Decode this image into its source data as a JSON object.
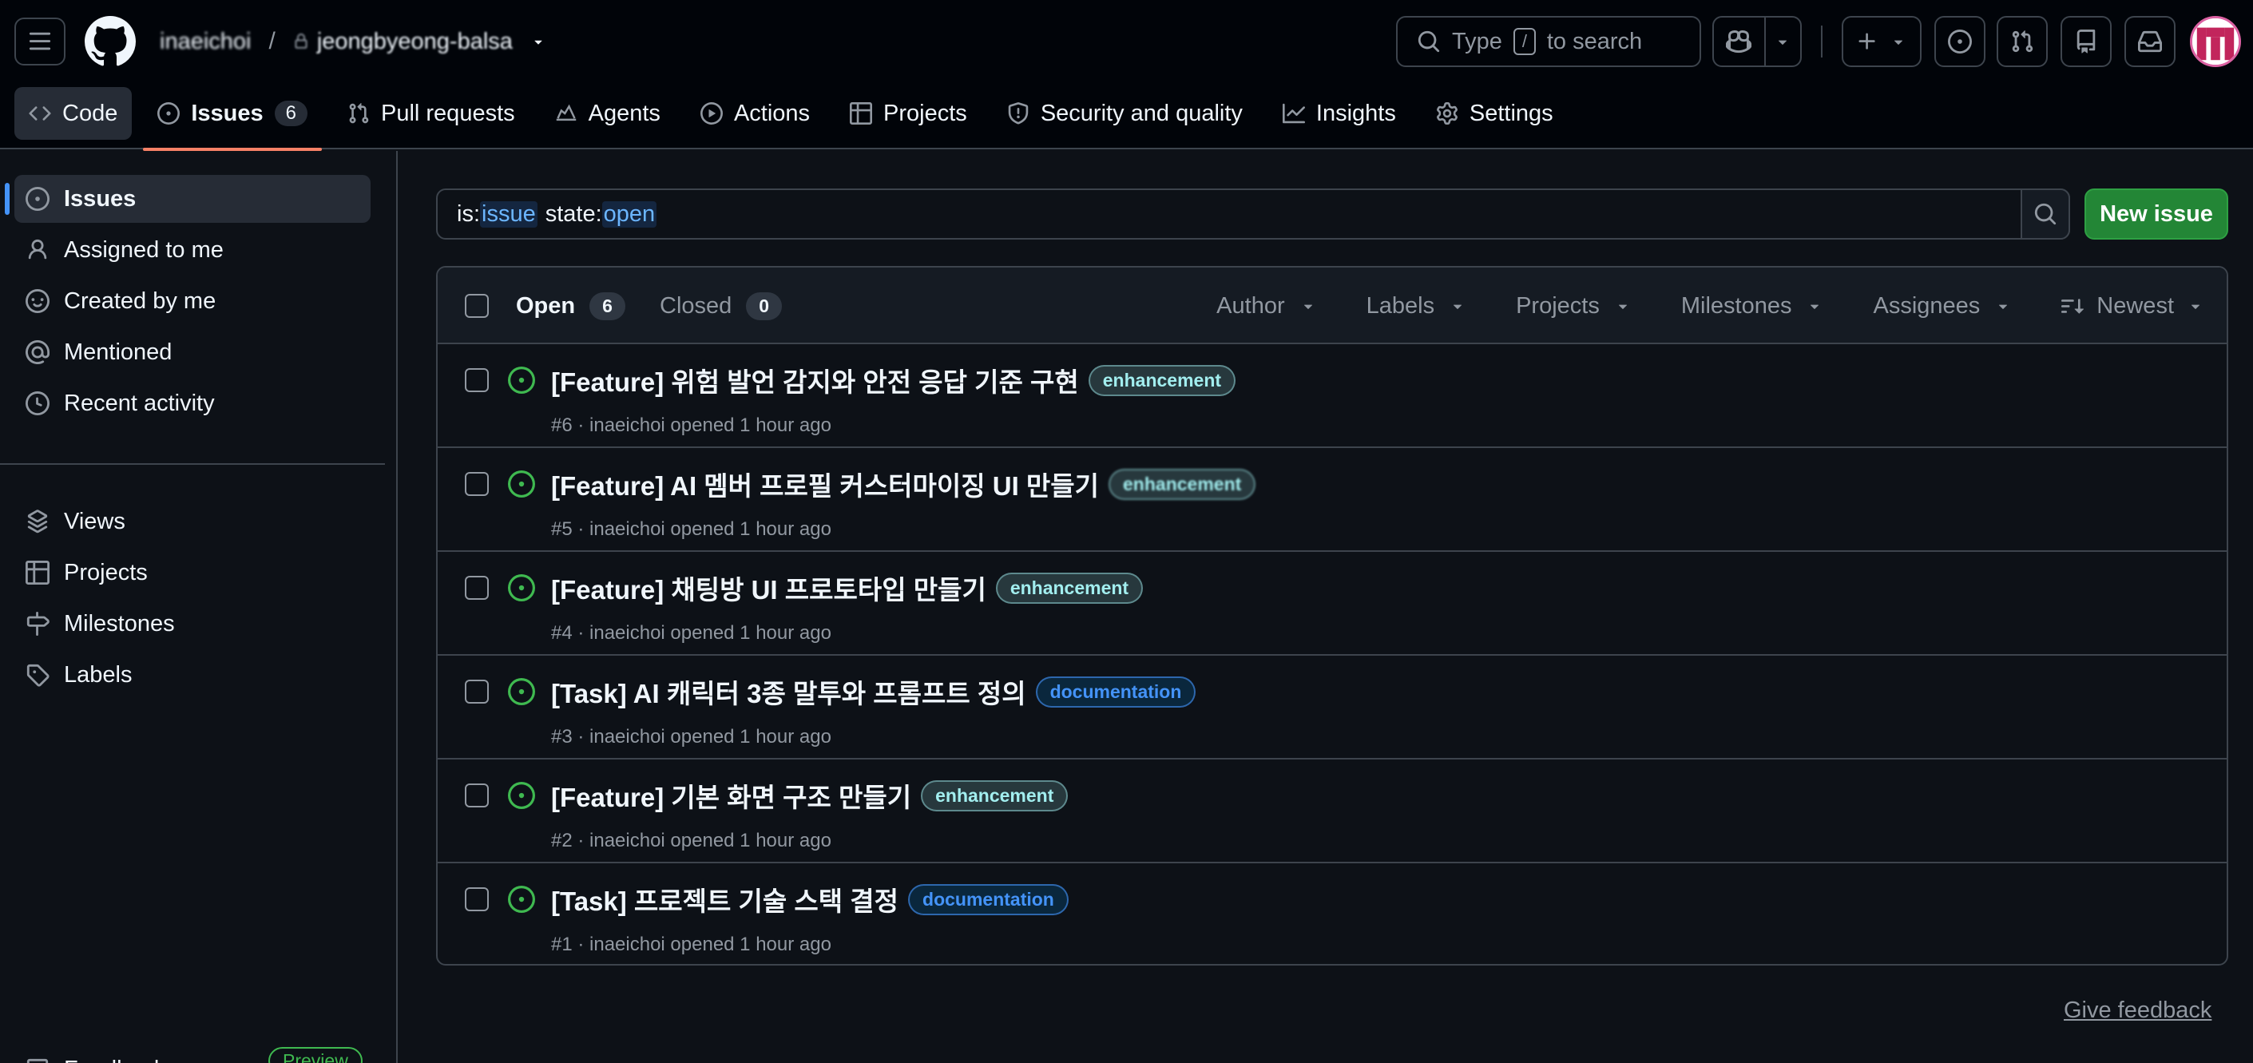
{
  "header": {
    "owner": "inaeichoi",
    "separator": "/",
    "repo": "jeongbyeong-balsa",
    "search_placeholder": "Type",
    "search_key": "/",
    "search_suffix": "to search",
    "avatar_text": "m"
  },
  "tabs": [
    {
      "label": "Code",
      "icon": "code-icon"
    },
    {
      "label": "Issues",
      "icon": "issue-opened-icon",
      "count": "6"
    },
    {
      "label": "Pull requests",
      "icon": "git-pull-request-icon"
    },
    {
      "label": "Agents",
      "icon": "agent-icon"
    },
    {
      "label": "Actions",
      "icon": "play-icon"
    },
    {
      "label": "Projects",
      "icon": "table-icon"
    },
    {
      "label": "Security and quality",
      "icon": "shield-icon"
    },
    {
      "label": "Insights",
      "icon": "graph-icon"
    },
    {
      "label": "Settings",
      "icon": "gear-icon"
    }
  ],
  "sidebar": {
    "items": [
      {
        "label": "Issues",
        "icon": "issue-opened-icon"
      },
      {
        "label": "Assigned to me",
        "icon": "person-icon"
      },
      {
        "label": "Created by me",
        "icon": "smiley-icon"
      },
      {
        "label": "Mentioned",
        "icon": "mention-icon"
      },
      {
        "label": "Recent activity",
        "icon": "clock-icon"
      }
    ],
    "items2": [
      {
        "label": "Views",
        "icon": "stack-icon"
      },
      {
        "label": "Projects",
        "icon": "table-icon"
      },
      {
        "label": "Milestones",
        "icon": "milestone-icon"
      },
      {
        "label": "Labels",
        "icon": "tag-icon"
      }
    ],
    "feedback": {
      "label": "Feedback",
      "badge": "Preview"
    }
  },
  "query": {
    "k1": "is:",
    "v1": "issue",
    "k2": "state:",
    "v2": "open"
  },
  "new_issue_label": "New issue",
  "list": {
    "open_label": "Open",
    "open_count": "6",
    "closed_label": "Closed",
    "closed_count": "0",
    "filters": [
      "Author",
      "Labels",
      "Projects",
      "Milestones",
      "Assignees"
    ],
    "sort_label": "Newest"
  },
  "issues": [
    {
      "title": "[Feature] 위험 발언 감지와 안전 응답 기준 구현",
      "label": "enhancement",
      "meta": "#6 · inaeichoi opened 1 hour ago"
    },
    {
      "title": "[Feature] AI 멤버 프로필 커스터마이징 UI 만들기",
      "label": "enhancement",
      "meta": "#5 · inaeichoi opened 1 hour ago"
    },
    {
      "title": "[Feature] 채팅방 UI 프로토타입 만들기",
      "label": "enhancement",
      "meta": "#4 · inaeichoi opened 1 hour ago"
    },
    {
      "title": "[Task] AI 캐릭터 3종 말투와 프롬프트 정의",
      "label": "documentation",
      "meta": "#3 · inaeichoi opened 1 hour ago"
    },
    {
      "title": "[Feature] 기본 화면 구조 만들기",
      "label": "enhancement",
      "meta": "#2 · inaeichoi opened 1 hour ago"
    },
    {
      "title": "[Task] 프로젝트 기술 스택 결정",
      "label": "documentation",
      "meta": "#1 · inaeichoi opened 1 hour ago"
    }
  ],
  "give_feedback": "Give feedback",
  "colors": {
    "accent_open": "#3fb950",
    "tab_underline": "#f78166",
    "new_issue_bg": "#238636",
    "background": "#0d1117"
  }
}
